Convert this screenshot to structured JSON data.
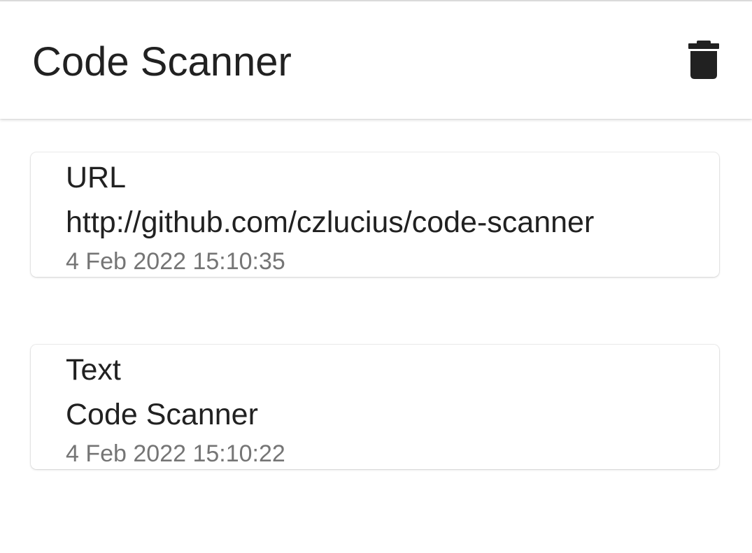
{
  "app_bar": {
    "title": "Code Scanner",
    "delete_icon": "trash-icon"
  },
  "history": [
    {
      "type": "URL",
      "content": "http://github.com/czlucius/code-scanner",
      "date": "4 Feb 2022 15:10:35"
    },
    {
      "type": "Text",
      "content": "Code Scanner",
      "date": "4 Feb 2022 15:10:22"
    }
  ],
  "colors": {
    "background": "#ffffff",
    "primary_text": "#212121",
    "secondary_text": "#757575",
    "icon": "#212121"
  }
}
